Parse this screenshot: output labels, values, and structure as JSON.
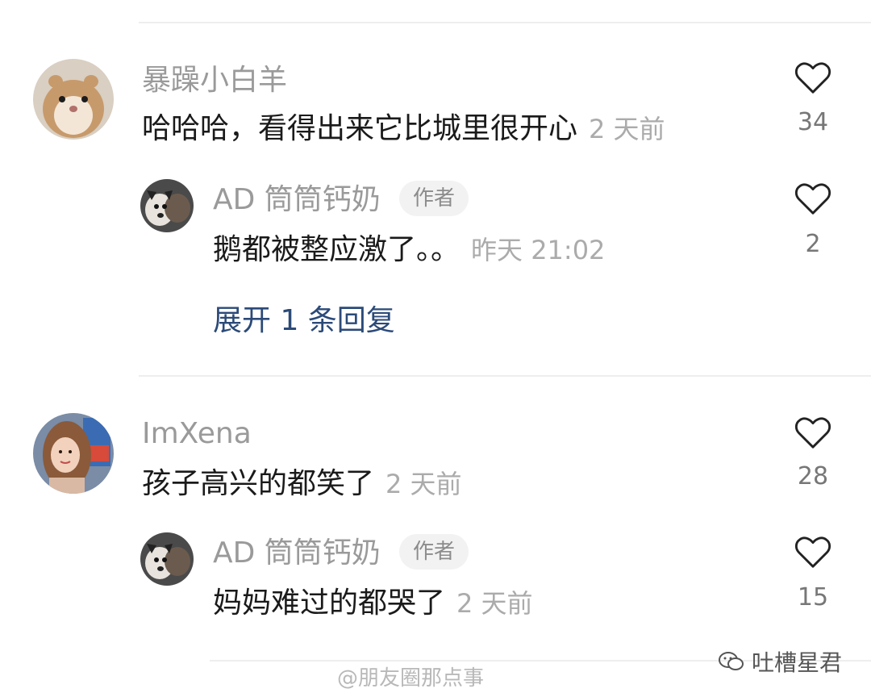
{
  "comments": [
    {
      "username": "暴躁小白羊",
      "text": "哈哈哈，看得出来它比城里很开心",
      "time": "2 天前",
      "likes": "34",
      "reply": {
        "username": "AD 筒筒钙奶",
        "badge": "作者",
        "text": "鹅都被整应激了。。",
        "time": "昨天 21:02",
        "likes": "2"
      },
      "expand_label": "展开 1 条回复"
    },
    {
      "username": "ImXena",
      "text": "孩子高兴的都笑了",
      "time": "2 天前",
      "likes": "28",
      "reply": {
        "username": "AD 筒筒钙奶",
        "badge": "作者",
        "text": "妈妈难过的都哭了",
        "time": "2 天前",
        "likes": "15"
      }
    }
  ],
  "icons": {
    "like": "heart-outline-icon"
  },
  "watermarks": {
    "left": "@朋友圈那点事",
    "right": "吐槽星君"
  },
  "colors": {
    "link": "#2b4a78",
    "meta": "#9a9a9a"
  }
}
